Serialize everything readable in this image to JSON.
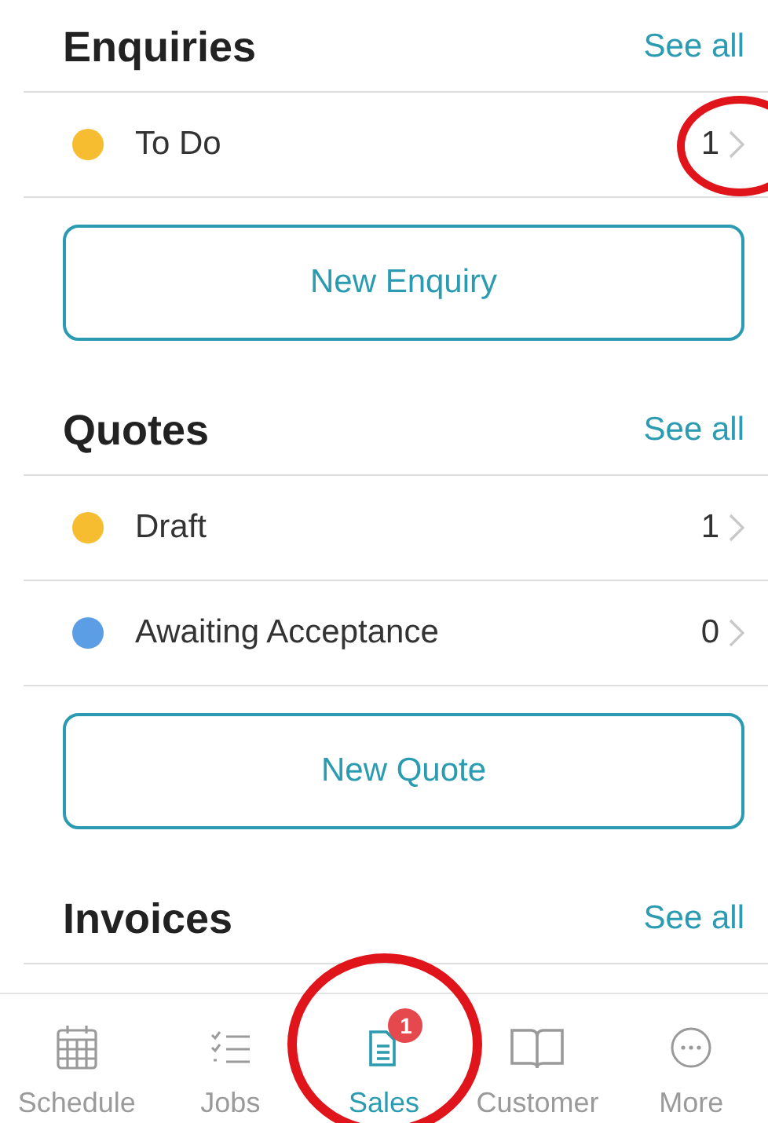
{
  "sections": [
    {
      "title": "Enquiries",
      "link": "See all",
      "rows": [
        {
          "label": "To Do",
          "count": "1",
          "color": "#f5bd2f",
          "circled": true
        }
      ],
      "button": "New Enquiry"
    },
    {
      "title": "Quotes",
      "link": "See all",
      "rows": [
        {
          "label": "Draft",
          "count": "1",
          "color": "#f5bd2f",
          "circled": false
        },
        {
          "label": "Awaiting Acceptance",
          "count": "0",
          "color": "#5b9ee6",
          "circled": false
        }
      ],
      "button": "New Quote"
    },
    {
      "title": "Invoices",
      "link": "See all"
    }
  ],
  "tabs": [
    {
      "kind": "calendar",
      "label": "Schedule",
      "selected": false,
      "circled": false
    },
    {
      "kind": "checklist",
      "label": "Jobs",
      "selected": false,
      "circled": false
    },
    {
      "kind": "document",
      "label": "Sales",
      "selected": true,
      "badge": "1",
      "circled": true
    },
    {
      "kind": "book",
      "label": "Customer",
      "selected": false,
      "circled": false
    },
    {
      "kind": "more",
      "label": "More",
      "selected": false,
      "circled": false
    }
  ]
}
